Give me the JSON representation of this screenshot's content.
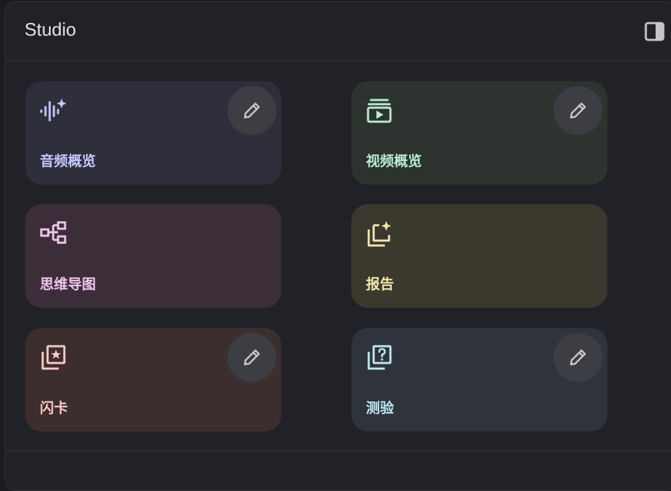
{
  "header": {
    "title": "Studio"
  },
  "cards": [
    {
      "label": "音频概览",
      "icon": "audio-sparkle-icon",
      "color": "#c5c7ff",
      "editable": true
    },
    {
      "label": "视频概览",
      "icon": "video-play-icon",
      "color": "#b9ecd2",
      "editable": true
    },
    {
      "label": "思维导图",
      "icon": "mind-map-icon",
      "color": "#f1c5f0",
      "editable": false
    },
    {
      "label": "报告",
      "icon": "report-sparkle-icon",
      "color": "#f2e6b0",
      "editable": false
    },
    {
      "label": "闪卡",
      "icon": "flashcard-star-icon",
      "color": "#ffcbc6",
      "editable": true
    },
    {
      "label": "测验",
      "icon": "quiz-question-icon",
      "color": "#bfe8f2",
      "editable": true
    }
  ]
}
